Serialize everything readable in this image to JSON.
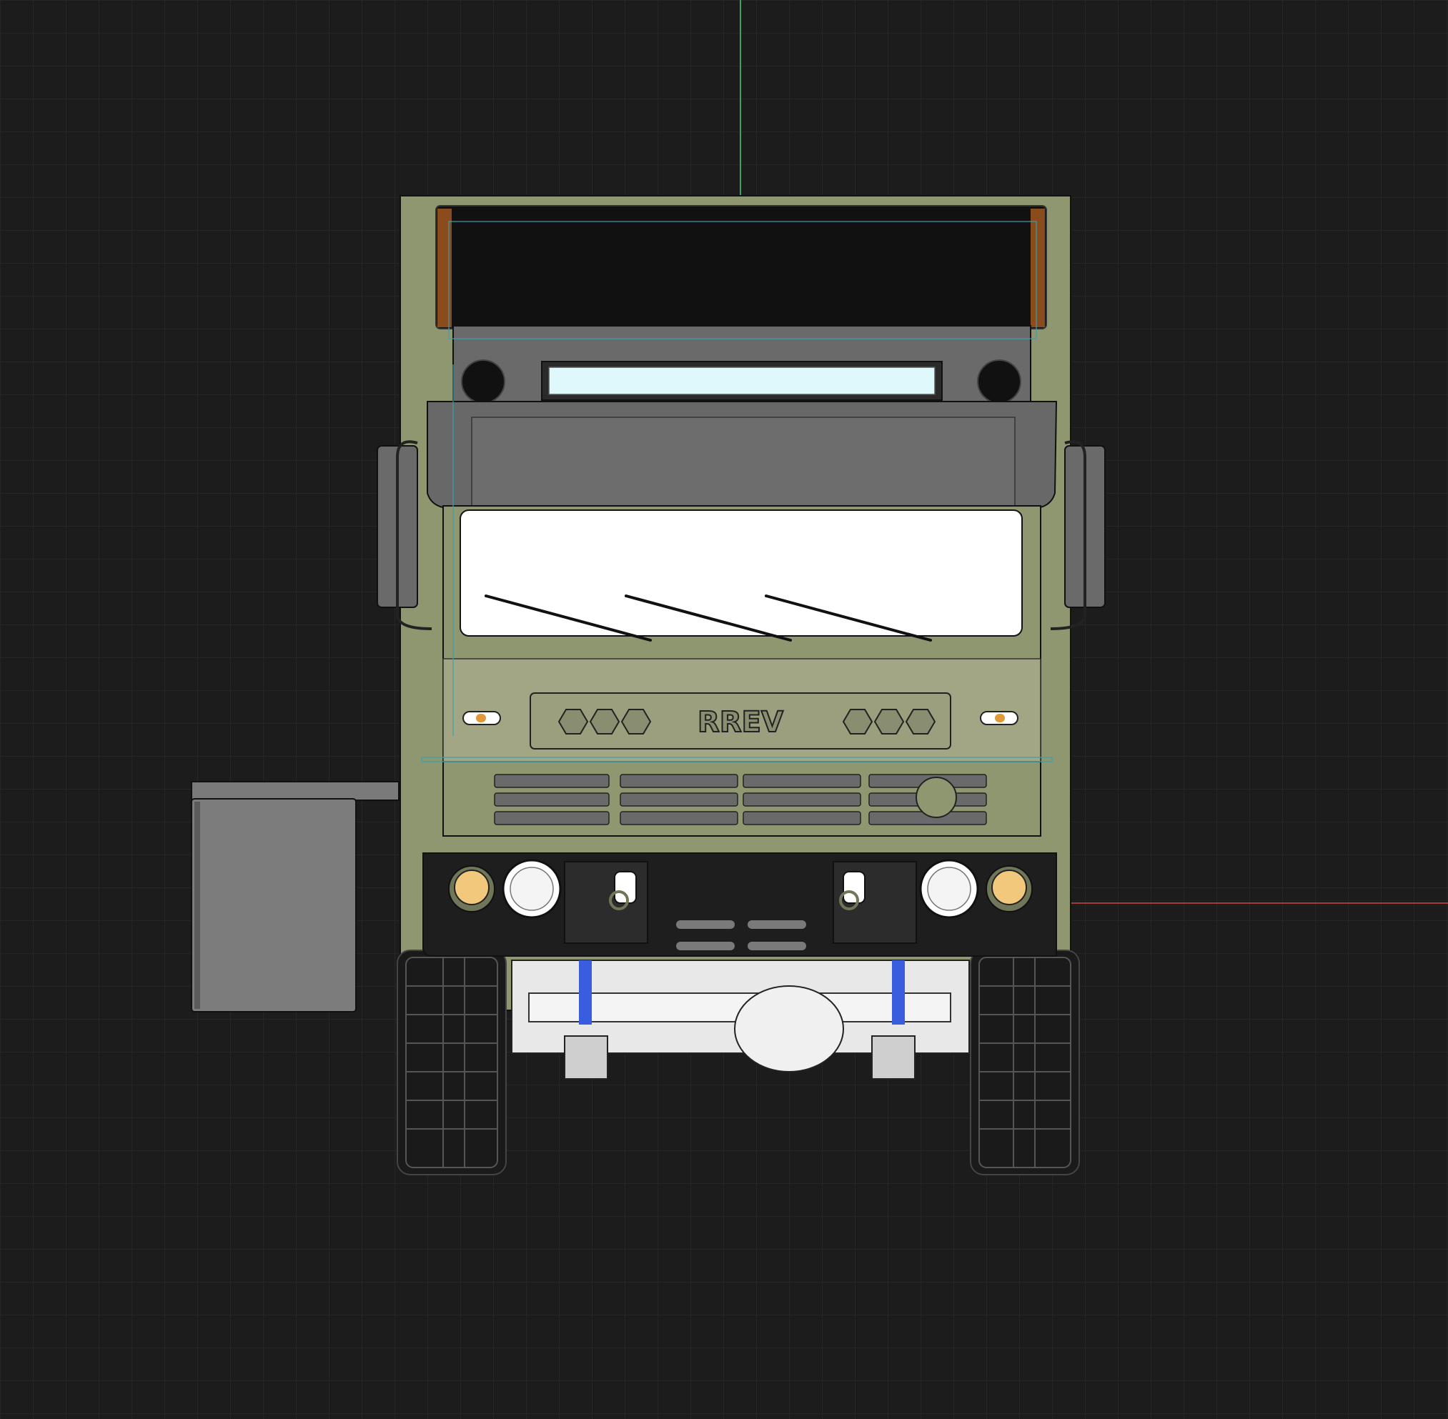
{
  "viewport": {
    "background_color": "#1c1c1c",
    "grid_color": "#262626",
    "y_axis_color": "#3aa35a",
    "x_axis_color": "#a33a3a"
  },
  "model": {
    "badge_text": "RREV",
    "colors": {
      "cab_body": "#8e9770",
      "cab_body_dark": "#6f7758",
      "cab_panel_light": "#a3a684",
      "windshield": "#111111",
      "sun_visor": "#686868",
      "light_bar": "#dff8fb",
      "window": "#ffffff",
      "bumper": "#1e1e1e",
      "tire": "#1a1a1a",
      "accent_orange": "#8a4c1c",
      "amber_light": "#f2c97c",
      "blue_spring": "#3a5de0",
      "selection_outline": "#3aa0b0"
    }
  }
}
